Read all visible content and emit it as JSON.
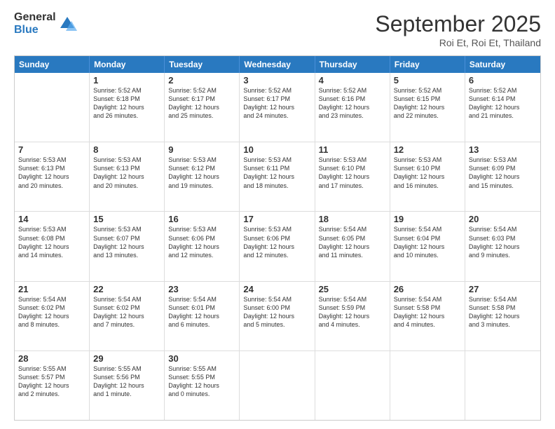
{
  "logo": {
    "general": "General",
    "blue": "Blue"
  },
  "header": {
    "month": "September 2025",
    "location": "Roi Et, Roi Et, Thailand"
  },
  "weekdays": [
    "Sunday",
    "Monday",
    "Tuesday",
    "Wednesday",
    "Thursday",
    "Friday",
    "Saturday"
  ],
  "rows": [
    [
      {
        "day": "",
        "text": ""
      },
      {
        "day": "1",
        "text": "Sunrise: 5:52 AM\nSunset: 6:18 PM\nDaylight: 12 hours\nand 26 minutes."
      },
      {
        "day": "2",
        "text": "Sunrise: 5:52 AM\nSunset: 6:17 PM\nDaylight: 12 hours\nand 25 minutes."
      },
      {
        "day": "3",
        "text": "Sunrise: 5:52 AM\nSunset: 6:17 PM\nDaylight: 12 hours\nand 24 minutes."
      },
      {
        "day": "4",
        "text": "Sunrise: 5:52 AM\nSunset: 6:16 PM\nDaylight: 12 hours\nand 23 minutes."
      },
      {
        "day": "5",
        "text": "Sunrise: 5:52 AM\nSunset: 6:15 PM\nDaylight: 12 hours\nand 22 minutes."
      },
      {
        "day": "6",
        "text": "Sunrise: 5:52 AM\nSunset: 6:14 PM\nDaylight: 12 hours\nand 21 minutes."
      }
    ],
    [
      {
        "day": "7",
        "text": "Sunrise: 5:53 AM\nSunset: 6:13 PM\nDaylight: 12 hours\nand 20 minutes."
      },
      {
        "day": "8",
        "text": "Sunrise: 5:53 AM\nSunset: 6:13 PM\nDaylight: 12 hours\nand 20 minutes."
      },
      {
        "day": "9",
        "text": "Sunrise: 5:53 AM\nSunset: 6:12 PM\nDaylight: 12 hours\nand 19 minutes."
      },
      {
        "day": "10",
        "text": "Sunrise: 5:53 AM\nSunset: 6:11 PM\nDaylight: 12 hours\nand 18 minutes."
      },
      {
        "day": "11",
        "text": "Sunrise: 5:53 AM\nSunset: 6:10 PM\nDaylight: 12 hours\nand 17 minutes."
      },
      {
        "day": "12",
        "text": "Sunrise: 5:53 AM\nSunset: 6:10 PM\nDaylight: 12 hours\nand 16 minutes."
      },
      {
        "day": "13",
        "text": "Sunrise: 5:53 AM\nSunset: 6:09 PM\nDaylight: 12 hours\nand 15 minutes."
      }
    ],
    [
      {
        "day": "14",
        "text": "Sunrise: 5:53 AM\nSunset: 6:08 PM\nDaylight: 12 hours\nand 14 minutes."
      },
      {
        "day": "15",
        "text": "Sunrise: 5:53 AM\nSunset: 6:07 PM\nDaylight: 12 hours\nand 13 minutes."
      },
      {
        "day": "16",
        "text": "Sunrise: 5:53 AM\nSunset: 6:06 PM\nDaylight: 12 hours\nand 12 minutes."
      },
      {
        "day": "17",
        "text": "Sunrise: 5:53 AM\nSunset: 6:06 PM\nDaylight: 12 hours\nand 12 minutes."
      },
      {
        "day": "18",
        "text": "Sunrise: 5:54 AM\nSunset: 6:05 PM\nDaylight: 12 hours\nand 11 minutes."
      },
      {
        "day": "19",
        "text": "Sunrise: 5:54 AM\nSunset: 6:04 PM\nDaylight: 12 hours\nand 10 minutes."
      },
      {
        "day": "20",
        "text": "Sunrise: 5:54 AM\nSunset: 6:03 PM\nDaylight: 12 hours\nand 9 minutes."
      }
    ],
    [
      {
        "day": "21",
        "text": "Sunrise: 5:54 AM\nSunset: 6:02 PM\nDaylight: 12 hours\nand 8 minutes."
      },
      {
        "day": "22",
        "text": "Sunrise: 5:54 AM\nSunset: 6:02 PM\nDaylight: 12 hours\nand 7 minutes."
      },
      {
        "day": "23",
        "text": "Sunrise: 5:54 AM\nSunset: 6:01 PM\nDaylight: 12 hours\nand 6 minutes."
      },
      {
        "day": "24",
        "text": "Sunrise: 5:54 AM\nSunset: 6:00 PM\nDaylight: 12 hours\nand 5 minutes."
      },
      {
        "day": "25",
        "text": "Sunrise: 5:54 AM\nSunset: 5:59 PM\nDaylight: 12 hours\nand 4 minutes."
      },
      {
        "day": "26",
        "text": "Sunrise: 5:54 AM\nSunset: 5:58 PM\nDaylight: 12 hours\nand 4 minutes."
      },
      {
        "day": "27",
        "text": "Sunrise: 5:54 AM\nSunset: 5:58 PM\nDaylight: 12 hours\nand 3 minutes."
      }
    ],
    [
      {
        "day": "28",
        "text": "Sunrise: 5:55 AM\nSunset: 5:57 PM\nDaylight: 12 hours\nand 2 minutes."
      },
      {
        "day": "29",
        "text": "Sunrise: 5:55 AM\nSunset: 5:56 PM\nDaylight: 12 hours\nand 1 minute."
      },
      {
        "day": "30",
        "text": "Sunrise: 5:55 AM\nSunset: 5:55 PM\nDaylight: 12 hours\nand 0 minutes."
      },
      {
        "day": "",
        "text": ""
      },
      {
        "day": "",
        "text": ""
      },
      {
        "day": "",
        "text": ""
      },
      {
        "day": "",
        "text": ""
      }
    ]
  ]
}
